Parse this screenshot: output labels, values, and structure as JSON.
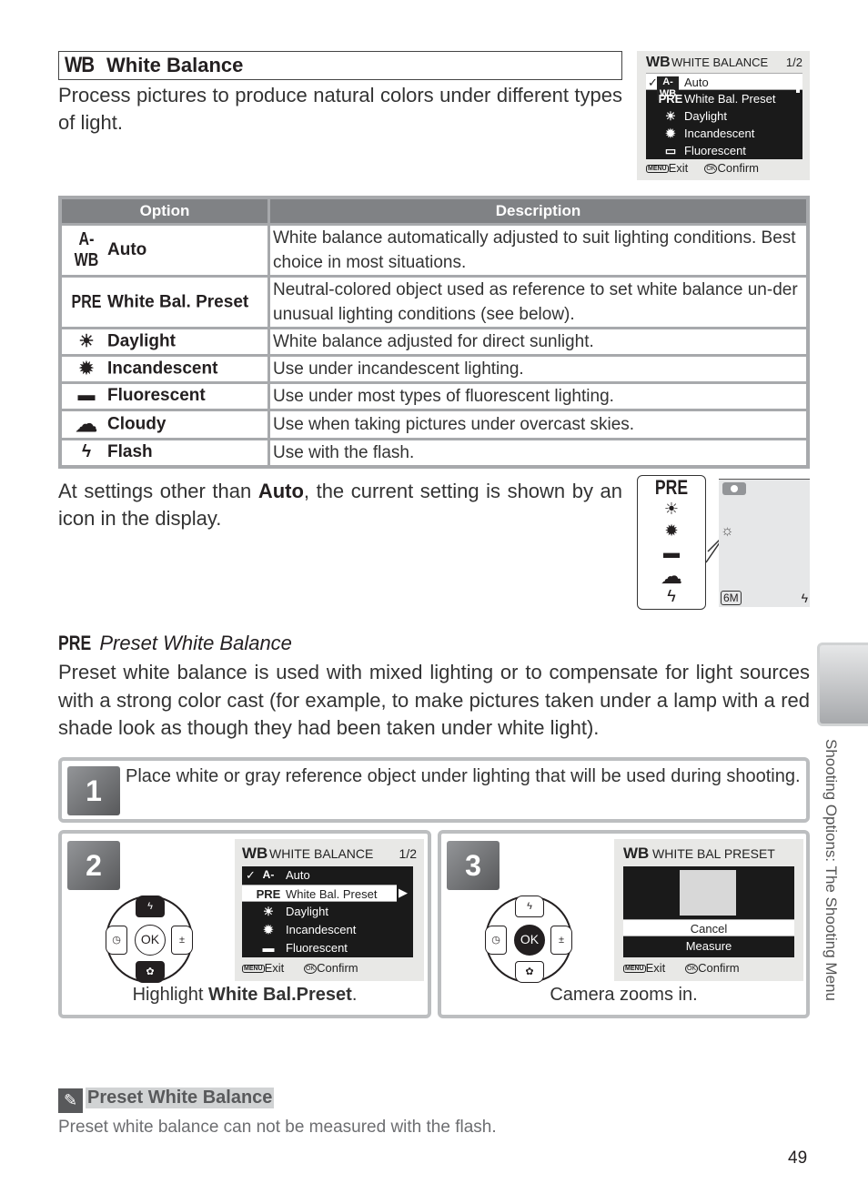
{
  "header": {
    "icon": "WB",
    "title": "White Balance",
    "intro": "Process pictures to produce natural colors under different types of light."
  },
  "menu_screen_1": {
    "header_icon": "WB",
    "title": "WHITE BALANCE",
    "page": "1/2",
    "items": [
      {
        "icon": "A-WB",
        "label": "Auto",
        "checked": true,
        "selected": true
      },
      {
        "icon": "PRE",
        "label": "White Bal. Preset"
      },
      {
        "icon": "daylight-icon",
        "glyph": "☀",
        "label": "Daylight"
      },
      {
        "icon": "incandescent-icon",
        "glyph": "✹",
        "label": "Incandescent"
      },
      {
        "icon": "fluorescent-icon",
        "glyph": "▭",
        "label": "Fluorescent"
      }
    ],
    "footer_exit": "Exit",
    "footer_confirm": "Confirm",
    "menu_chip": "MENU",
    "ok_chip": "OK"
  },
  "table": {
    "headers": [
      "Option",
      "Description"
    ],
    "rows": [
      {
        "icon": "A-WB",
        "option": "Auto",
        "description": "White balance automatically adjusted to suit lighting conditions. Best choice in most situations."
      },
      {
        "icon": "PRE",
        "option": "White Bal. Preset",
        "description": "Neutral-colored object used as reference to set white balance un-der unusual lighting conditions (see below)."
      },
      {
        "icon": "☀",
        "option": "Daylight",
        "description": "White balance adjusted for direct sunlight."
      },
      {
        "icon": "✹",
        "option": "Incandescent",
        "description": "Use under incandescent lighting."
      },
      {
        "icon": "▬",
        "option": "Fluorescent",
        "description": "Use under most types of fluorescent lighting."
      },
      {
        "icon": "☁",
        "option": "Cloudy",
        "description": "Use when taking pictures under overcast skies."
      },
      {
        "icon": "ϟ",
        "option": "Flash",
        "description": "Use with the flash."
      }
    ]
  },
  "settings_note": {
    "before": "At settings other than ",
    "bold": "Auto",
    "after": ", the current setting is shown by an icon in the display."
  },
  "icon_panel": {
    "icons": [
      "PRE",
      "☀",
      "✹",
      "▬",
      "☁",
      "ϟ"
    ]
  },
  "display_preview": {
    "image_size": "6M",
    "wb_indicator": "☼",
    "flash_indicator": "ϟ"
  },
  "preset_section": {
    "icon": "PRE",
    "title": "Preset White Balance",
    "body": "Preset white balance is used with mixed lighting or to compensate for light sources with a strong color cast (for example, to make pictures taken under a lamp with a red shade look as though they had been taken under white light)."
  },
  "steps": [
    {
      "number": "1",
      "text": "Place white or gray reference object under lighting that will be used during shooting."
    },
    {
      "number": "2",
      "caption_before": "Highlight ",
      "caption_bold": "White Bal.Preset",
      "caption_after": ".",
      "screen": {
        "header_icon": "WB",
        "title": "WHITE BALANCE",
        "page": "1/2",
        "items": [
          {
            "icon": "A-WB",
            "label": "Auto",
            "checked": true
          },
          {
            "icon": "PRE",
            "label": "White Bal. Preset",
            "selected": true
          },
          {
            "icon": "☀",
            "label": "Daylight"
          },
          {
            "icon": "✹",
            "label": "Incandescent"
          },
          {
            "icon": "▬",
            "label": "Fluorescent"
          }
        ],
        "footer_exit": "Exit",
        "footer_confirm": "Confirm"
      },
      "dpad": {
        "center": "OK",
        "up": "ϟ",
        "down": "✿",
        "left": "◷",
        "right": "±",
        "pressed": "down"
      }
    },
    {
      "number": "3",
      "caption": "Camera zooms in.",
      "screen": {
        "header_icon": "WB",
        "title": "WHITE BAL PRESET",
        "options": [
          "Cancel",
          "Measure"
        ],
        "selected": "Cancel",
        "footer_exit": "Exit",
        "footer_confirm": "Confirm"
      },
      "dpad": {
        "center": "OK",
        "up": "ϟ",
        "down": "✿",
        "left": "◷",
        "right": "±",
        "pressed": "center"
      }
    }
  ],
  "side_tab": {
    "label": "Shooting Options: The Shooting Menu"
  },
  "note": {
    "icon": "✎",
    "title": "Preset White Balance",
    "body": "Preset white balance can not be measured with the flash."
  },
  "page_number": "49"
}
